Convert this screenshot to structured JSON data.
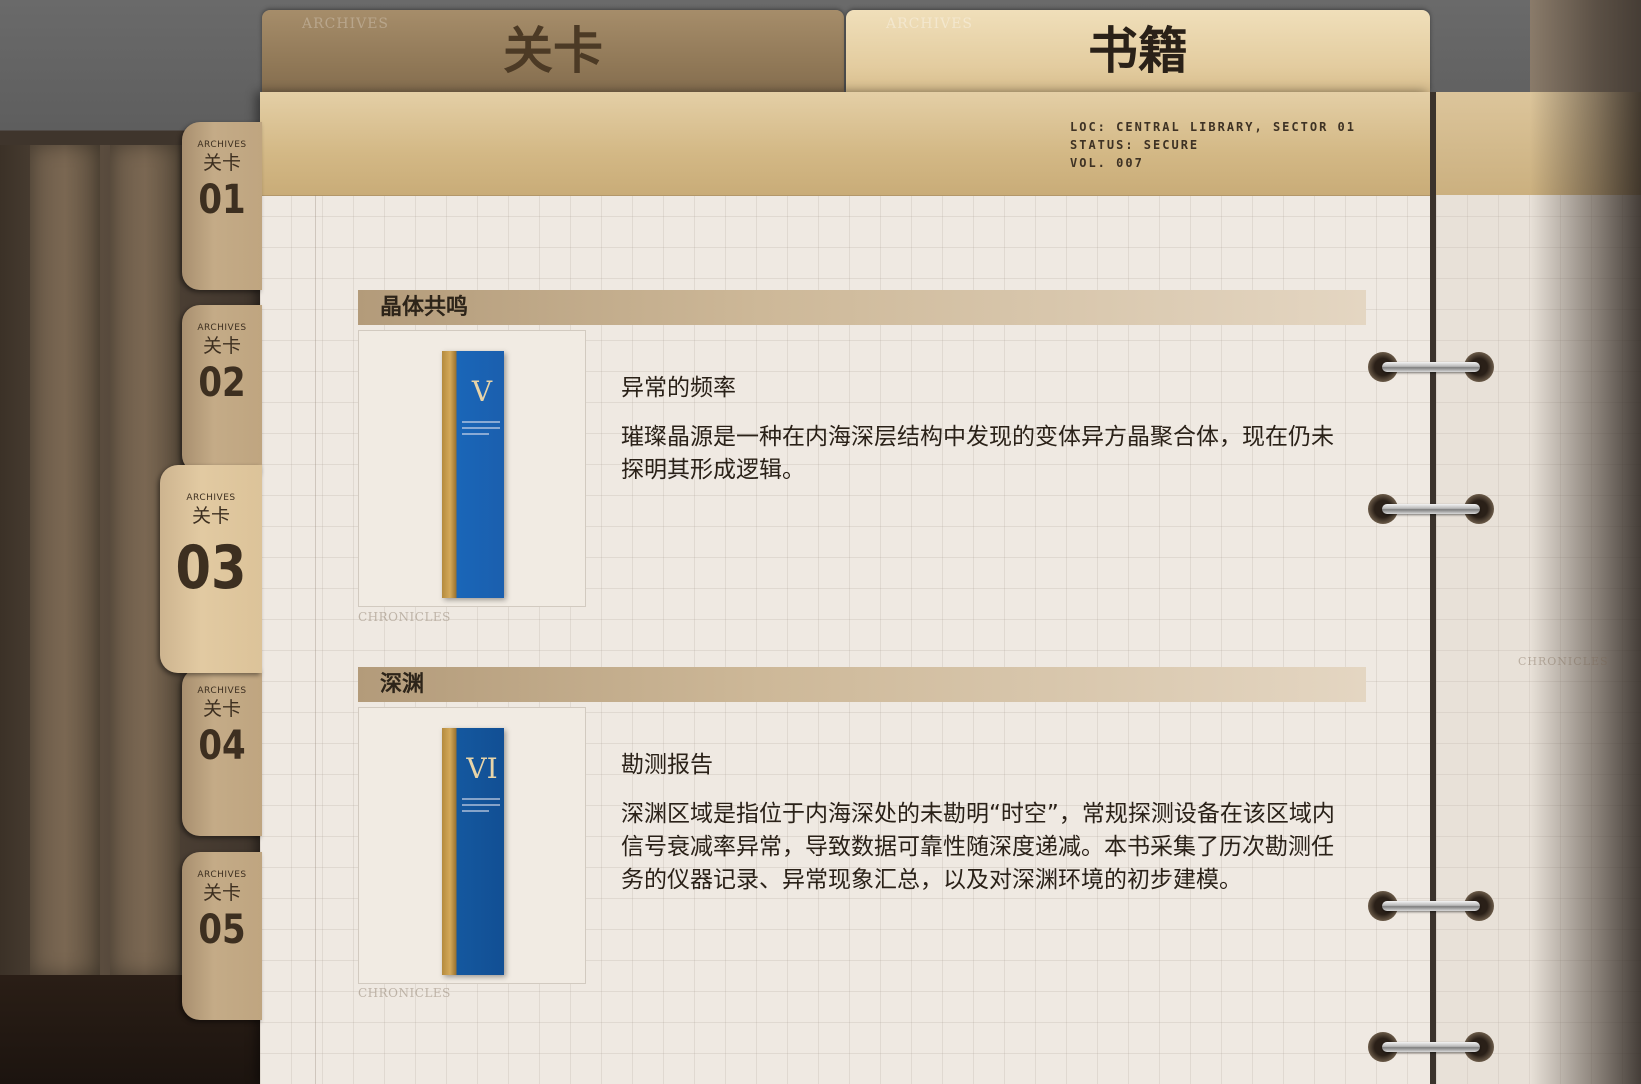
{
  "top_tabs": {
    "levels_label": "关卡",
    "books_label": "书籍",
    "watermark": "ARCHIVES"
  },
  "header_info": {
    "loc": "LOC: CENTRAL LIBRARY, SECTOR 01",
    "status": "STATUS: SECURE",
    "vol": "VOL. 007"
  },
  "side_tabs": [
    {
      "archives": "ARCHIVES",
      "label": "关卡",
      "number": "01"
    },
    {
      "archives": "ARCHIVES",
      "label": "关卡",
      "number": "02"
    },
    {
      "archives": "ARCHIVES",
      "label": "关卡",
      "number": "03"
    },
    {
      "archives": "ARCHIVES",
      "label": "关卡",
      "number": "04"
    },
    {
      "archives": "ARCHIVES",
      "label": "关卡",
      "number": "05"
    }
  ],
  "active_side_tab": "03",
  "books": [
    {
      "section": "晶体共鸣",
      "roman": "V",
      "cover_caption": "CHRONICLES",
      "title": "异常的频率",
      "description": "璀璨晶源是一种在内海深层结构中发现的变体异方晶聚合体，现在仍未探明其形成逻辑。"
    },
    {
      "section": "深渊",
      "roman": "VI",
      "cover_caption": "CHRONICLES",
      "title": "勘测报告",
      "description": "深渊区域是指位于内海深处的未勘明“时空”，常规探测设备在该区域内信号衰减率异常，导致数据可靠性随深度递减。本书采集了历次勘测任务的仪器记录、异常现象汇总，以及对深渊环境的初步建模。"
    }
  ],
  "right_page_label": "CHRONICLES"
}
